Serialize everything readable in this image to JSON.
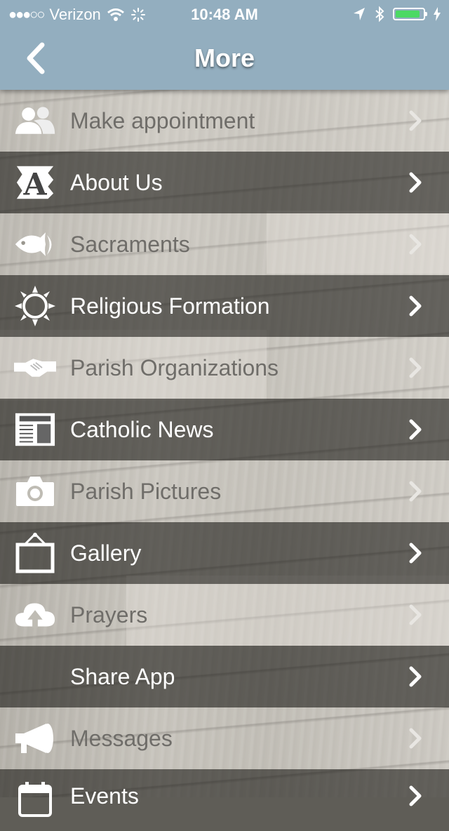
{
  "status_bar": {
    "carrier": "Verizon",
    "time": "10:48 AM",
    "signal_dots": "●●●○○"
  },
  "navbar": {
    "title": "More",
    "back_icon": "chevron-left-icon"
  },
  "menu": {
    "items": [
      {
        "label": "Make appointment",
        "icon": "people-icon",
        "style": "light"
      },
      {
        "label": "About Us",
        "icon": "letter-a-icon",
        "style": "dark"
      },
      {
        "label": "Sacraments",
        "icon": "fish-icon",
        "style": "light"
      },
      {
        "label": "Religious Formation",
        "icon": "sun-icon",
        "style": "dark"
      },
      {
        "label": "Parish Organizations",
        "icon": "handshake-icon",
        "style": "light"
      },
      {
        "label": "Catholic News",
        "icon": "newspaper-icon",
        "style": "dark"
      },
      {
        "label": "Parish Pictures",
        "icon": "camera-icon",
        "style": "light"
      },
      {
        "label": "Gallery",
        "icon": "picture-frame-icon",
        "style": "dark"
      },
      {
        "label": "Prayers",
        "icon": "cloud-upload-icon",
        "style": "light"
      },
      {
        "label": "Share App",
        "icon": "",
        "style": "dark"
      },
      {
        "label": "Messages",
        "icon": "megaphone-icon",
        "style": "light"
      },
      {
        "label": "Events",
        "icon": "calendar-icon",
        "style": "dark"
      }
    ]
  },
  "colors": {
    "navbar": "#93aebf",
    "battery": "#4cd964"
  }
}
